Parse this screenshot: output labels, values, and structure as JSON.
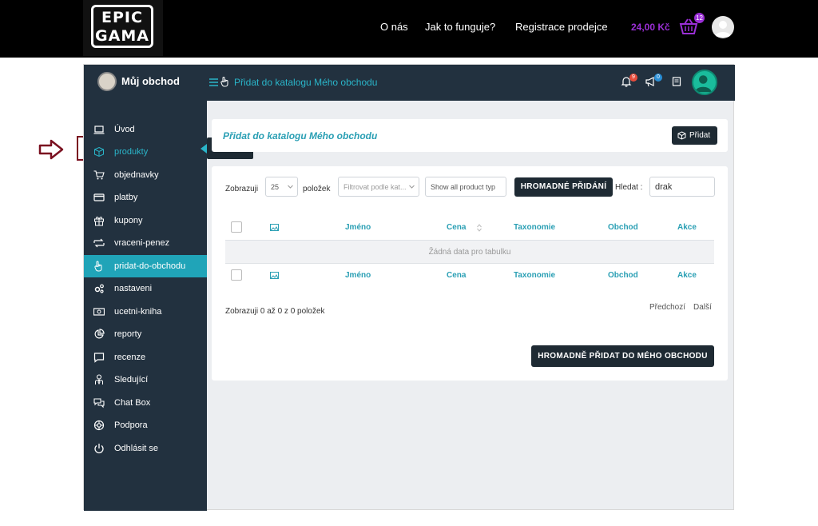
{
  "site": {
    "logo_line1": "EPIC",
    "logo_line2": "GAMA",
    "nav": [
      "O nás",
      "Jak to funguje?",
      "Registrace prodejce"
    ],
    "cart_price": "24,00 Kč",
    "cart_count": "12"
  },
  "app": {
    "brand": "Můj obchod",
    "breadcrumb": "Přidat do katalogu Mého obchodu",
    "notif_count": "9",
    "announce_count": "0"
  },
  "sidebar": {
    "items": [
      {
        "label": "Úvod",
        "icon": "laptop-icon"
      },
      {
        "label": "produkty",
        "icon": "box-icon"
      },
      {
        "label": "objednavky",
        "icon": "cart-icon"
      },
      {
        "label": "platby",
        "icon": "credit-card-icon"
      },
      {
        "label": "kupony",
        "icon": "gift-icon"
      },
      {
        "label": "vraceni-penez",
        "icon": "exchange-icon"
      },
      {
        "label": "pridat-do-obchodu",
        "icon": "hand-pointer-icon"
      },
      {
        "label": "nastaveni",
        "icon": "gears-icon"
      },
      {
        "label": "ucetni-kniha",
        "icon": "money-icon"
      },
      {
        "label": "reporty",
        "icon": "pie-chart-icon"
      },
      {
        "label": "recenze",
        "icon": "comment-icon"
      },
      {
        "label": "Sledující",
        "icon": "user-tie-icon"
      },
      {
        "label": "Chat Box",
        "icon": "chat-icon"
      },
      {
        "label": "Podpora",
        "icon": "lifebuoy-icon"
      },
      {
        "label": "Odhlásit se",
        "icon": "power-icon"
      }
    ],
    "active_index": 6,
    "highlighted_index": 1
  },
  "tooltip": "Přidat",
  "panel": {
    "title": "Přidat do katalogu Mého obchodu",
    "add_button": "Přidat"
  },
  "table_controls": {
    "show_label": "Zobrazuji",
    "page_size": "25",
    "items_label": "položek",
    "category_filter_placeholder": "Filtrovat podle kat...",
    "product_type_value": "Show all product typ",
    "bulk_add_button": "HROMADNÉ PŘIDÁNÍ",
    "search_label": "Hledat :",
    "search_value": "drak"
  },
  "table": {
    "columns": [
      "Jméno",
      "Cena",
      "Taxonomie",
      "Obchod",
      "Akce"
    ],
    "empty_message": "Žádná data pro tabulku",
    "info": "Zobrazuji 0 až 0 z 0 položek",
    "prev": "Předchozí",
    "next": "Další"
  },
  "bulk_store_button": "HROMADNĚ PŘIDAT DO MÉHO OBCHODU",
  "colors": {
    "accent": "#2ab5c9",
    "sidebar_bg": "#22313f",
    "active_item": "#20a4b8",
    "price": "#9b2fd6",
    "annotation": "#7a1020"
  }
}
